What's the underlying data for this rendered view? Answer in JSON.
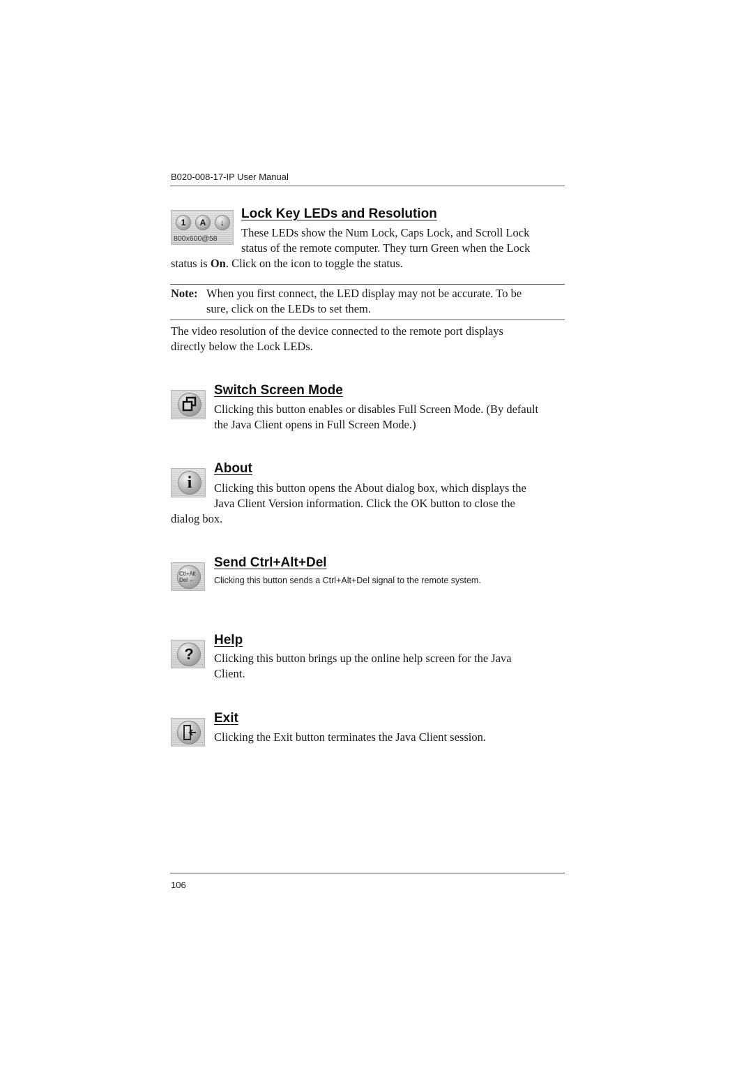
{
  "header": {
    "title": "B020-008-17-IP User Manual"
  },
  "sections": {
    "lock_leds": {
      "heading": "Lock Key LEDs and Resolution",
      "icon": {
        "name": "lock-key-leds-icon",
        "leds": [
          "1",
          "A",
          "↓"
        ],
        "resolution_label": "800x600@58"
      },
      "para_line1": "These LEDs show the Num Lock, Caps Lock, and Scroll Lock",
      "para_line2": "status of the remote computer. They turn Green when the Lock",
      "para_line3_pre": "status is ",
      "para_line3_bold": "On",
      "para_line3_post": ". Click on the icon to toggle the status.",
      "note_label": "Note:",
      "note_line1": "When you first connect, the LED display may not be accurate. To be",
      "note_line2": "sure, click on the LEDs to set them.",
      "resolution_para_line1": "The video resolution of the device connected to the remote port displays",
      "resolution_para_line2": "directly below the Lock LEDs."
    },
    "switch_screen": {
      "heading": "Switch Screen Mode",
      "icon": "switch-screen-mode-icon",
      "line1": "Clicking this button enables or disables Full Screen Mode. (By default",
      "line2": "the Java Client opens in Full Screen Mode.)"
    },
    "about": {
      "heading": "About",
      "icon": "info-icon",
      "glyph": "i",
      "line1": "Clicking this button opens the About dialog box, which displays the",
      "line2": "Java Client Version information. Click the OK button to close the",
      "line3": "dialog box."
    },
    "ctrl_alt_del": {
      "heading": "Send Ctrl+Alt+Del",
      "icon": "ctrl-alt-del-icon",
      "glyph_line1": "Ctl+Alt",
      "glyph_line2": "Del ←",
      "line1": "Clicking this button sends a Ctrl+Alt+Del signal to the remote system."
    },
    "help": {
      "heading": "Help",
      "icon": "help-icon",
      "glyph": "?",
      "line1": "Clicking this button brings up the online help screen for the Java",
      "line2": "Client."
    },
    "exit": {
      "heading": "Exit",
      "icon": "exit-icon",
      "line1": "Clicking the Exit button terminates the Java Client session."
    }
  },
  "footer": {
    "page_number": "106"
  }
}
